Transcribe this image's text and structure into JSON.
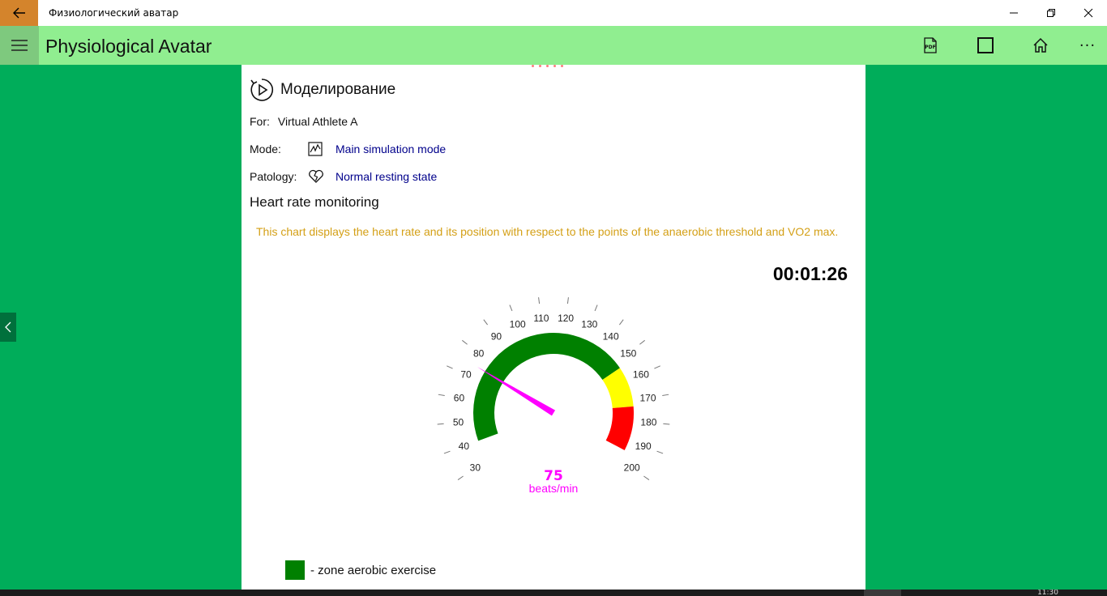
{
  "window": {
    "title": "Физиологический аватар",
    "controls": [
      "minimize",
      "restore",
      "close"
    ]
  },
  "appbar": {
    "title": "Physiological Avatar",
    "buttons": [
      "pdf-icon",
      "square-icon",
      "home-icon",
      "more-icon"
    ],
    "pdf_label": "PDF",
    "more_label": "···"
  },
  "content": {
    "section_title": "Моделирование",
    "for_label": "For:",
    "for_value": "Virtual Athlete A",
    "mode_label": "Mode:",
    "mode_value": "Main simulation mode",
    "pathology_label": "Patology:",
    "pathology_value": "Normal resting state",
    "hr_title": "Heart rate monitoring",
    "description": "This chart displays the heart rate and its position with respect to the points of the anaerobic threshold and VO2 max.",
    "timer": "00:01:26"
  },
  "gauge": {
    "min": 30,
    "max": 200,
    "ticks": [
      30,
      40,
      50,
      60,
      70,
      80,
      90,
      100,
      110,
      120,
      130,
      140,
      150,
      160,
      170,
      180,
      190,
      200
    ],
    "zones": [
      {
        "from": 40,
        "to": 153,
        "color": "#008000"
      },
      {
        "from": 153,
        "to": 173,
        "color": "#ffff00"
      },
      {
        "from": 173,
        "to": 195,
        "color": "#ff0000"
      }
    ],
    "value": 75,
    "unit": "beats/min",
    "needle_color": "#ff00ff"
  },
  "legend": {
    "items": [
      {
        "label": "- zone aerobic exercise",
        "color": "#008000"
      }
    ]
  },
  "colors": {
    "background": "#00ad5a",
    "appbar": "#90ee90",
    "back_button": "#d4842c",
    "description_text": "#d4a017",
    "link": "#00008b"
  },
  "taskbar": {
    "time": "11:30"
  }
}
